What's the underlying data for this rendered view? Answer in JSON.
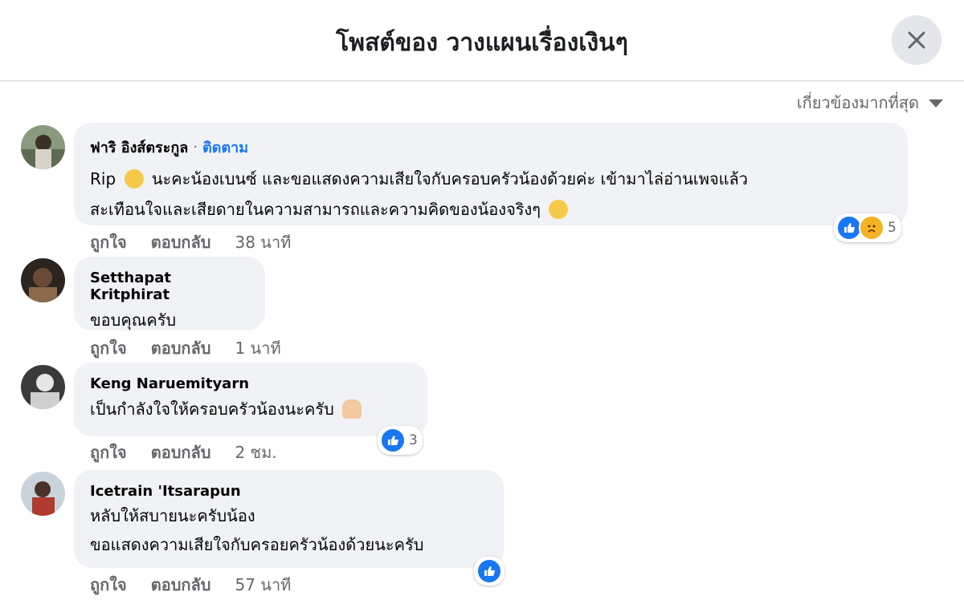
{
  "header": {
    "title": "โพสต์ของ วางแผนเรื่องเงินๆ"
  },
  "sort": {
    "label": "เกี่ยวข้องมากที่สุด"
  },
  "comments": [
    {
      "author": "ฟาริ อิงส์ตระกูล",
      "follow_label": "ติดตาม",
      "text_line1_a": "Rip",
      "text_line1_b": "นะคะน้องเบนซ์ และขอแสดงความเสียใจกับครอบครัวน้องด้วยค่ะ เข้ามาไล่อ่านเพจแล้ว",
      "text_line2": "สะเทือนใจและเสียดายในความสามารถและความคิดของน้องจริงๆ",
      "like_label": "ถูกใจ",
      "reply_label": "ตอบกลับ",
      "time": "38 นาที",
      "reaction_count": "5"
    },
    {
      "author": "Setthapat Kritphirat",
      "text_line1": "ขอบคุณครับ",
      "like_label": "ถูกใจ",
      "reply_label": "ตอบกลับ",
      "time": "1 นาที"
    },
    {
      "author": "Keng Naruemityarn",
      "text_line1": "เป็นกำลังใจให้ครอบครัวน้องนะครับ",
      "like_label": "ถูกใจ",
      "reply_label": "ตอบกลับ",
      "time": "2 ชม.",
      "reaction_count": "3"
    },
    {
      "author": "Icetrain 'Itsarapun",
      "text_line1": "หลับให้สบายนะครับน้อง",
      "text_line2": "ขอแสดงความเสียใจกับครอยครัวน้องด้วยนะครับ",
      "like_label": "ถูกใจ",
      "reply_label": "ตอบกลับ",
      "time": "57 นาที"
    }
  ],
  "colors": {
    "accent": "#1877f2",
    "bubble": "#f0f2f5",
    "muted": "#65676b"
  }
}
